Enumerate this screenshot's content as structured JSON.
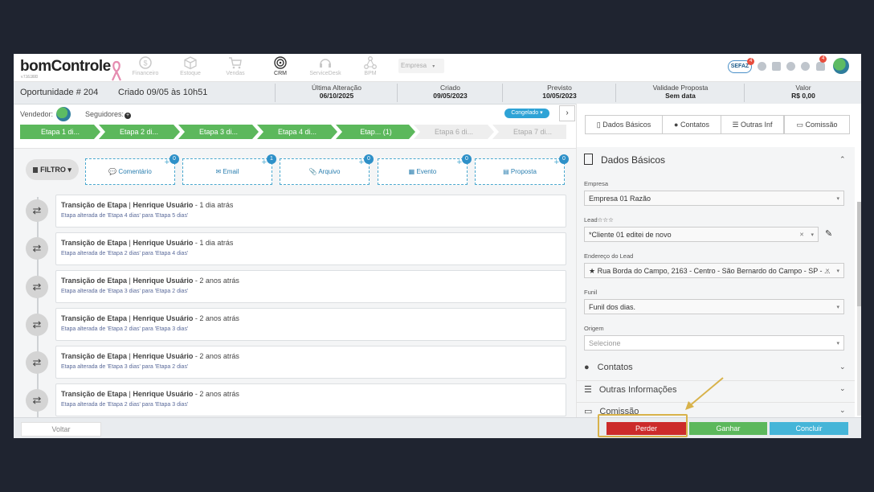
{
  "app": {
    "logo": "bomControle",
    "version": "v 7.16.1600",
    "nav": [
      "Financeiro",
      "Estoque",
      "Vendas",
      "CRM",
      "ServiceDesk",
      "BPM"
    ],
    "empresa_select": "Empresa",
    "sefaz": "SEFAZ",
    "sefaz_badge": "4",
    "notif_badge": "4"
  },
  "info": {
    "opportunity": "Oportunidade # 204",
    "created": "Criado 09/05 às 10h51",
    "cols": [
      {
        "label": "Última Alteração",
        "value": "06/10/2025"
      },
      {
        "label": "Criado",
        "value": "09/05/2023"
      },
      {
        "label": "Previsto",
        "value": "10/05/2023"
      },
      {
        "label": "Validade Proposta",
        "value": "Sem data"
      },
      {
        "label": "Valor",
        "value": "R$ 0,00"
      }
    ]
  },
  "people": {
    "vendedor": "Vendedor:",
    "seguidores": "Seguidores:",
    "congelado": "Congelado ▾",
    "arrow": "›"
  },
  "stages": [
    "Etapa 1 di...",
    "Etapa 2 di...",
    "Etapa 3 di...",
    "Etapa 4 di...",
    "Etap... (1)",
    "Etapa 6 di...",
    "Etapa 7 di..."
  ],
  "filters": {
    "filtro": "FILTRO ▾",
    "items": [
      {
        "label": "Comentário",
        "count": "0"
      },
      {
        "label": "Email",
        "count": "1"
      },
      {
        "label": "Arquivo",
        "count": "0"
      },
      {
        "label": "Evento",
        "count": "0"
      },
      {
        "label": "Proposta",
        "count": "0"
      }
    ]
  },
  "timeline": [
    {
      "title": "Transição de Etapa",
      "user": "Henrique Usuário",
      "when": " - 1 dia atrás",
      "detail": "Etapa alterada de 'Etapa 4 dias' para 'Etapa 5 dias'"
    },
    {
      "title": "Transição de Etapa",
      "user": "Henrique Usuário",
      "when": " - 1 dia atrás",
      "detail": "Etapa alterada de 'Etapa 2 dias' para 'Etapa 4 dias'"
    },
    {
      "title": "Transição de Etapa",
      "user": "Henrique Usuário",
      "when": " - 2 anos atrás",
      "detail": "Etapa alterada de 'Etapa 3 dias' para 'Etapa 2 dias'"
    },
    {
      "title": "Transição de Etapa",
      "user": "Henrique Usuário",
      "when": " - 2 anos atrás",
      "detail": "Etapa alterada de 'Etapa 2 dias' para 'Etapa 3 dias'"
    },
    {
      "title": "Transição de Etapa",
      "user": "Henrique Usuário",
      "when": " - 2 anos atrás",
      "detail": "Etapa alterada de 'Etapa 3 dias' para 'Etapa 2 dias'"
    },
    {
      "title": "Transição de Etapa",
      "user": "Henrique Usuário",
      "when": " - 2 anos atrás",
      "detail": "Etapa alterada de 'Etapa 2 dias' para 'Etapa 3 dias'"
    }
  ],
  "right": {
    "tabs": [
      "Dados Básicos",
      "Contatos",
      "Outras Inf",
      "Comissão"
    ],
    "section_title": "Dados Básicos",
    "empresa_label": "Empresa",
    "empresa_value": "Empresa 01 Razão",
    "lead_label": "Lead☆☆☆",
    "lead_value": "*Cliente 01 editei de novo",
    "endereco_label": "Endereço do Lead",
    "endereco_value": "★ Rua Borda do Campo, 2163 - Centro - São Bernardo do Campo - SP - ...",
    "funil_label": "Funil",
    "funil_value": "Funil dos dias.",
    "origem_label": "Origem",
    "origem_value": "Selecione",
    "contatos": "Contatos",
    "outras": "Outras Informações",
    "comissao": "Comissão"
  },
  "bottom": {
    "voltar": "Voltar",
    "perder": "Perder",
    "ganhar": "Ganhar",
    "concluir": "Concluir"
  },
  "colors": {
    "stage_done": "#5cb85c",
    "stage_todo": "#eeeeee",
    "perder": "#cc2b2b",
    "ganhar": "#5cb85c",
    "concluir": "#45b5d8",
    "highlight": "#d8b24a"
  }
}
